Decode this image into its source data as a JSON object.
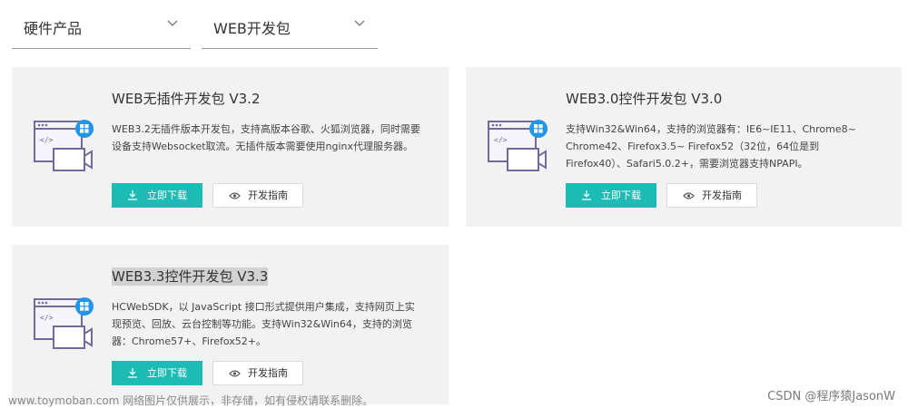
{
  "filters": [
    {
      "label": "硬件产品",
      "icon": "chevron-down-icon"
    },
    {
      "label": "WEB开发包",
      "icon": "chevron-down-icon"
    }
  ],
  "cards": [
    {
      "title": "WEB无插件开发包 V3.2",
      "description": "WEB3.2无插件版本开发包，支持高版本谷歌、火狐浏览器，同时需要设备支持Websocket取流。无插件版本需要使用nginx代理服务器。",
      "download_label": "立即下载",
      "guide_label": "开发指南",
      "highlighted": false
    },
    {
      "title": "WEB3.0控件开发包 V3.0",
      "description": "支持Win32&Win64，支持的浏览器有：IE6~IE11、Chrome8~ Chrome42、Firefox3.5~ Firefox52（32位，64位是到Firefox40）、Safari5.0.2+，需要浏览器支持NPAPI。",
      "download_label": "立即下载",
      "guide_label": "开发指南",
      "highlighted": false
    },
    {
      "title": "WEB3.3控件开发包 V3.3",
      "description": "HCWebSDK，以 JavaScript 接口形式提供用户集成，支持网页上实现预览、回放、云台控制等功能。支持Win32&Win64，支持的浏览器：Chrome57+、Firefox52+。",
      "download_label": "立即下载",
      "guide_label": "开发指南",
      "highlighted": true
    }
  ],
  "colors": {
    "accent": "#1cbbb4",
    "card_bg": "#f2f2f2",
    "windows_blue": "#2196e8",
    "icon_purple": "#6f6b9c"
  },
  "watermark": "www.toymoban.com 网络图片仅供展示，非存储，如有侵权请联系删除。",
  "credit": "CSDN @程序猿JasonW"
}
